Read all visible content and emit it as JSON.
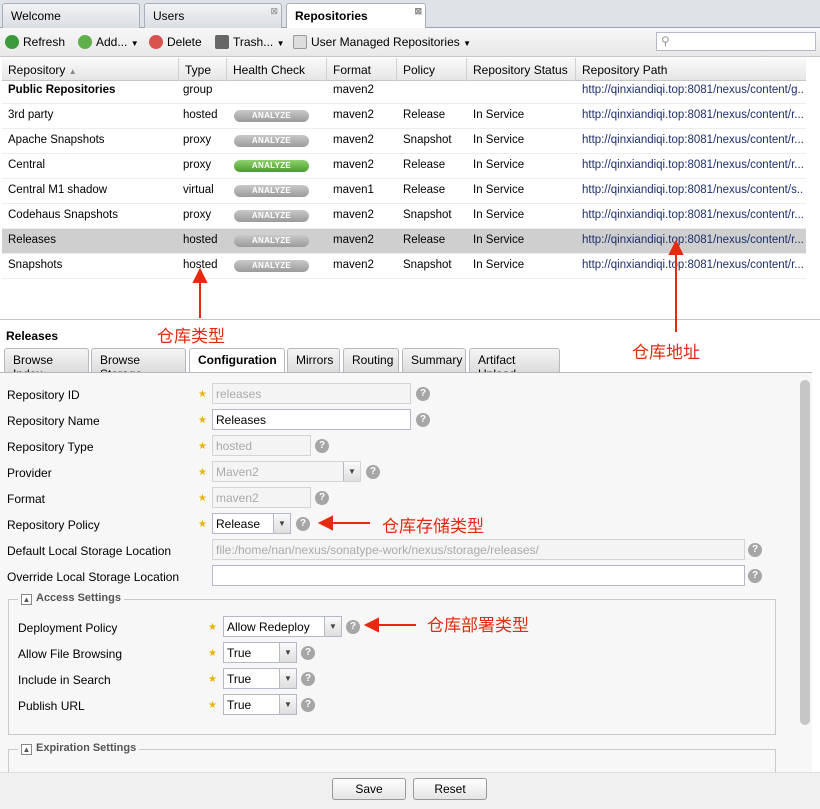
{
  "top_tabs": [
    {
      "label": "Welcome"
    },
    {
      "label": "Users"
    },
    {
      "label": "Repositories"
    }
  ],
  "toolbar": {
    "refresh": "Refresh",
    "add": "Add...",
    "delete": "Delete",
    "trash": "Trash...",
    "user_managed": "User Managed Repositories"
  },
  "grid": {
    "headers": [
      "Repository",
      "Type",
      "Health Check",
      "Format",
      "Policy",
      "Repository Status",
      "Repository Path"
    ],
    "badge": "ANALYZE",
    "rows": [
      {
        "name": "Public Repositories",
        "type": "group",
        "format": "maven2",
        "policy": "",
        "status": "",
        "path": "http://qinxiandiqi.top:8081/nexus/content/g..."
      },
      {
        "name": "3rd party",
        "type": "hosted",
        "format": "maven2",
        "policy": "Release",
        "status": "In Service",
        "path": "http://qinxiandiqi.top:8081/nexus/content/r..."
      },
      {
        "name": "Apache Snapshots",
        "type": "proxy",
        "format": "maven2",
        "policy": "Snapshot",
        "status": "In Service",
        "path": "http://qinxiandiqi.top:8081/nexus/content/r..."
      },
      {
        "name": "Central",
        "type": "proxy",
        "format": "maven2",
        "policy": "Release",
        "status": "In Service",
        "path": "http://qinxiandiqi.top:8081/nexus/content/r..."
      },
      {
        "name": "Central M1 shadow",
        "type": "virtual",
        "format": "maven1",
        "policy": "Release",
        "status": "In Service",
        "path": "http://qinxiandiqi.top:8081/nexus/content/s..."
      },
      {
        "name": "Codehaus Snapshots",
        "type": "proxy",
        "format": "maven2",
        "policy": "Snapshot",
        "status": "In Service",
        "path": "http://qinxiandiqi.top:8081/nexus/content/r..."
      },
      {
        "name": "Releases",
        "type": "hosted",
        "format": "maven2",
        "policy": "Release",
        "status": "In Service",
        "path": "http://qinxiandiqi.top:8081/nexus/content/r..."
      },
      {
        "name": "Snapshots",
        "type": "hosted",
        "format": "maven2",
        "policy": "Snapshot",
        "status": "In Service",
        "path": "http://qinxiandiqi.top:8081/nexus/content/r..."
      }
    ]
  },
  "detail": {
    "title": "Releases",
    "tabs": [
      "Browse Index",
      "Browse Storage",
      "Configuration",
      "Mirrors",
      "Routing",
      "Summary",
      "Artifact Upload"
    ],
    "labels": {
      "repo_id": "Repository ID",
      "repo_name": "Repository Name",
      "repo_type": "Repository Type",
      "provider": "Provider",
      "format": "Format",
      "policy": "Repository Policy",
      "default_loc": "Default Local Storage Location",
      "override_loc": "Override Local Storage Location"
    },
    "values": {
      "repo_id": "releases",
      "repo_name": "Releases",
      "repo_type": "hosted",
      "provider": "Maven2",
      "format": "maven2",
      "policy": "Release",
      "default_loc": "file:/home/nan/nexus/sonatype-work/nexus/storage/releases/",
      "override_loc": ""
    },
    "access": {
      "title": "Access Settings",
      "deployment_label": "Deployment Policy",
      "deployment_value": "Allow Redeploy",
      "browsing_label": "Allow File Browsing",
      "browsing_value": "True",
      "search_label": "Include in Search",
      "search_value": "True",
      "publish_label": "Publish URL",
      "publish_value": "True"
    },
    "expiration": {
      "title": "Expiration Settings"
    },
    "save": "Save",
    "reset": "Reset"
  },
  "annotations": {
    "repo_type": "仓库类型",
    "repo_path": "仓库地址",
    "storage_type": "仓库存储类型",
    "deploy_type": "仓库部署类型"
  },
  "colors": {
    "annotation": "#e62a10",
    "link": "#1d2f6b",
    "green_badge": "#4a9b2a"
  }
}
